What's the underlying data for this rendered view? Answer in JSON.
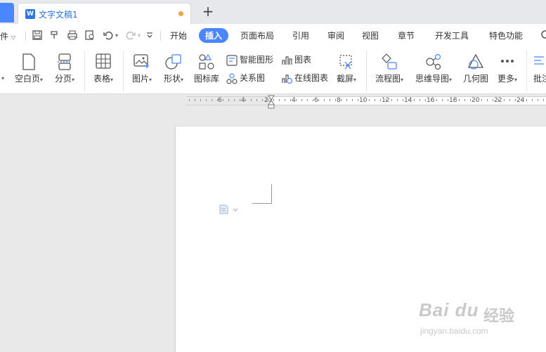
{
  "tabs": {
    "doc_title": "文字文稿1",
    "add": "+"
  },
  "menubar": {
    "file": "件",
    "tabs": [
      "开始",
      "插入",
      "页面布局",
      "引用",
      "审阅",
      "视图",
      "章节",
      "开发工具",
      "特色功能"
    ],
    "active_tab": "插入"
  },
  "ribbon": {
    "blank_page": "空白页",
    "page_break": "分页",
    "table": "表格",
    "picture": "图片",
    "shape": "形状",
    "icon_lib": "图标库",
    "smart_art": "智能图形",
    "chart": "图表",
    "relation_chart": "关系图",
    "online_chart": "在线图表",
    "screenshot": "截屏",
    "flowchart": "流程图",
    "mindmap": "思维导图",
    "geometry": "几何图",
    "more": "更多",
    "comment": "批注"
  },
  "ruler": {
    "left_numbers": [
      "6",
      "4",
      "2"
    ],
    "right_numbers": [
      "2",
      "4",
      "6",
      "8",
      "10",
      "12",
      "14",
      "16",
      "18",
      "20",
      "22",
      "24"
    ]
  },
  "watermark": {
    "brand": "Bai du",
    "site": "jingyan.baidu.com",
    "cn": "经验"
  },
  "colors": {
    "accent": "#4a86ff",
    "tab_title": "#2c6fde",
    "modified_dot": "#f2a14b"
  }
}
